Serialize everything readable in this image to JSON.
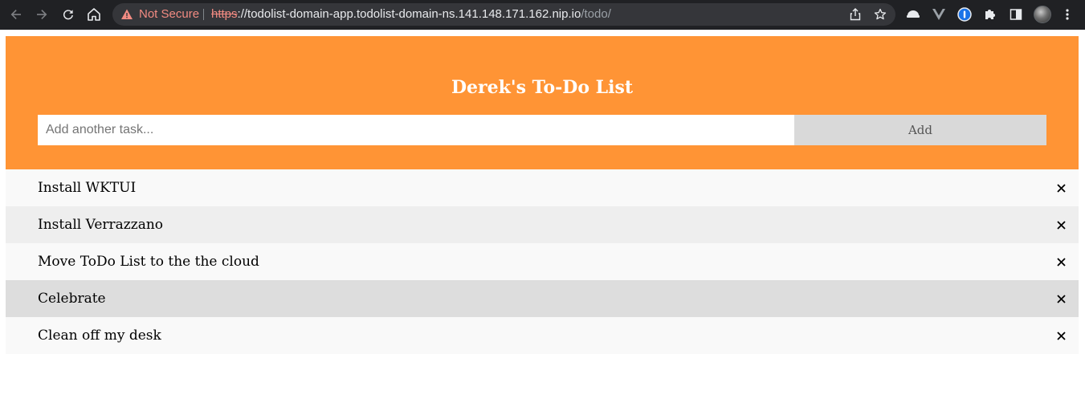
{
  "browser": {
    "security_label": "Not Secure",
    "url_scheme": "https",
    "url_separator": "://",
    "url_host": "todolist-domain-app.todolist-domain-ns.141.148.171.162.nip.io",
    "url_path": "/todo/",
    "icons": [
      "back-arrow-icon",
      "forward-arrow-icon",
      "reload-icon",
      "home-icon",
      "warning-triangle-icon",
      "share-icon",
      "star-icon",
      "extension-hat-icon",
      "vue-devtools-icon",
      "password-manager-icon",
      "puzzle-extensions-icon",
      "side-panel-icon",
      "profile-avatar",
      "kebab-menu-icon"
    ]
  },
  "header": {
    "title": "Derek's To-Do List",
    "input_placeholder": "Add another task...",
    "add_button_label": "Add",
    "background_color": "#ff9435"
  },
  "todos": [
    {
      "text": "Install WKTUI",
      "close_glyph": "×"
    },
    {
      "text": "Install Verrazzano",
      "close_glyph": "×"
    },
    {
      "text": "Move ToDo List to the the cloud",
      "close_glyph": "×"
    },
    {
      "text": "Celebrate",
      "close_glyph": "×"
    },
    {
      "text": "Clean off my desk",
      "close_glyph": "×"
    }
  ]
}
